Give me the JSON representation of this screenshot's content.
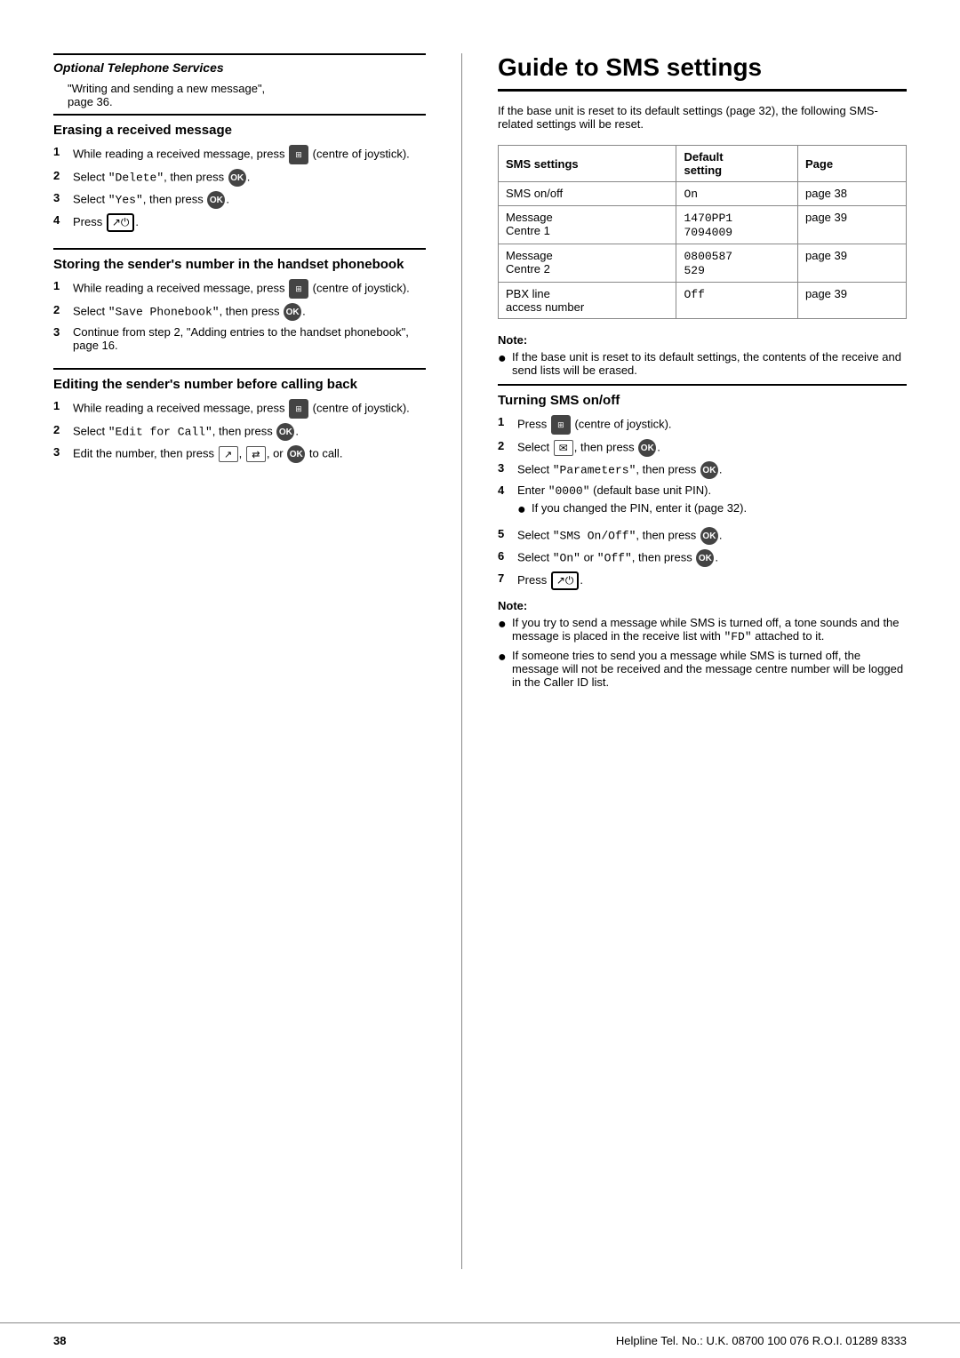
{
  "page": {
    "title": "Guide to SMS settings",
    "footer": {
      "page_number": "38",
      "helpline": "Helpline Tel. No.: U.K. 08700 100 076  R.O.I. 01289 8333"
    }
  },
  "left_col": {
    "section_header": "Optional Telephone Services",
    "intro_lines": [
      "\"Writing and sending a new message\",",
      "page 36."
    ],
    "erasing": {
      "title": "Erasing a received message",
      "steps": [
        "While reading a received message, press [joystick] (centre of joystick).",
        "Select \"Delete\", then press [OK].",
        "Select \"Yes\", then press [OK].",
        "Press [power]."
      ]
    },
    "storing": {
      "title": "Storing the sender's number in the handset phonebook",
      "steps": [
        "While reading a received message, press [joystick] (centre of joystick).",
        "Select \"Save Phonebook\", then press [OK].",
        "Continue from step 2, \"Adding entries to the handset phonebook\", page 16."
      ]
    },
    "editing": {
      "title": "Editing the sender's number before calling back",
      "steps": [
        "While reading a received message, press [joystick] (centre of joystick).",
        "Select \"Edit for Call\", then press [OK].",
        "Edit the number, then press [call], [transfer], or [OK] to call."
      ]
    }
  },
  "right_col": {
    "intro": "If the base unit is reset to its default settings (page 32), the following SMS-related settings will be reset.",
    "table": {
      "headers": [
        "SMS settings",
        "Default setting",
        "Page"
      ],
      "rows": [
        {
          "setting": "SMS on/off",
          "default": "On",
          "page": "page 38"
        },
        {
          "setting": "Message Centre 1",
          "default": "1470PP1\n7094009",
          "page": "page 39"
        },
        {
          "setting": "Message Centre 2",
          "default": "0800587\n529",
          "page": "page 39"
        },
        {
          "setting": "PBX line access number",
          "default": "Off",
          "page": "page 39"
        }
      ]
    },
    "note1": {
      "label": "Note:",
      "bullets": [
        "If the base unit is reset to its default settings, the contents of the receive and send lists will be erased."
      ]
    },
    "turning_sms": {
      "title": "Turning SMS on/off",
      "steps": [
        "Press [joystick] (centre of joystick).",
        "Select [sms-icon], then press [OK].",
        "Select \"Parameters\", then press [OK].",
        "Enter \"0000\" (default base unit PIN).",
        "Select \"SMS On/Off\", then press [OK].",
        "Select \"On\" or \"Off\", then press [OK].",
        "Press [power]."
      ],
      "step4_sub": "● If you changed the PIN, enter it (page 32).",
      "note_label": "Note:",
      "note_bullets": [
        "If you try to send a message while SMS is turned off, a tone sounds and the message is placed in the receive list with \"FD\" attached to it.",
        "If someone tries to send you a message while SMS is turned off, the message will not be received and the message centre number will be logged in the Caller ID list."
      ]
    }
  }
}
